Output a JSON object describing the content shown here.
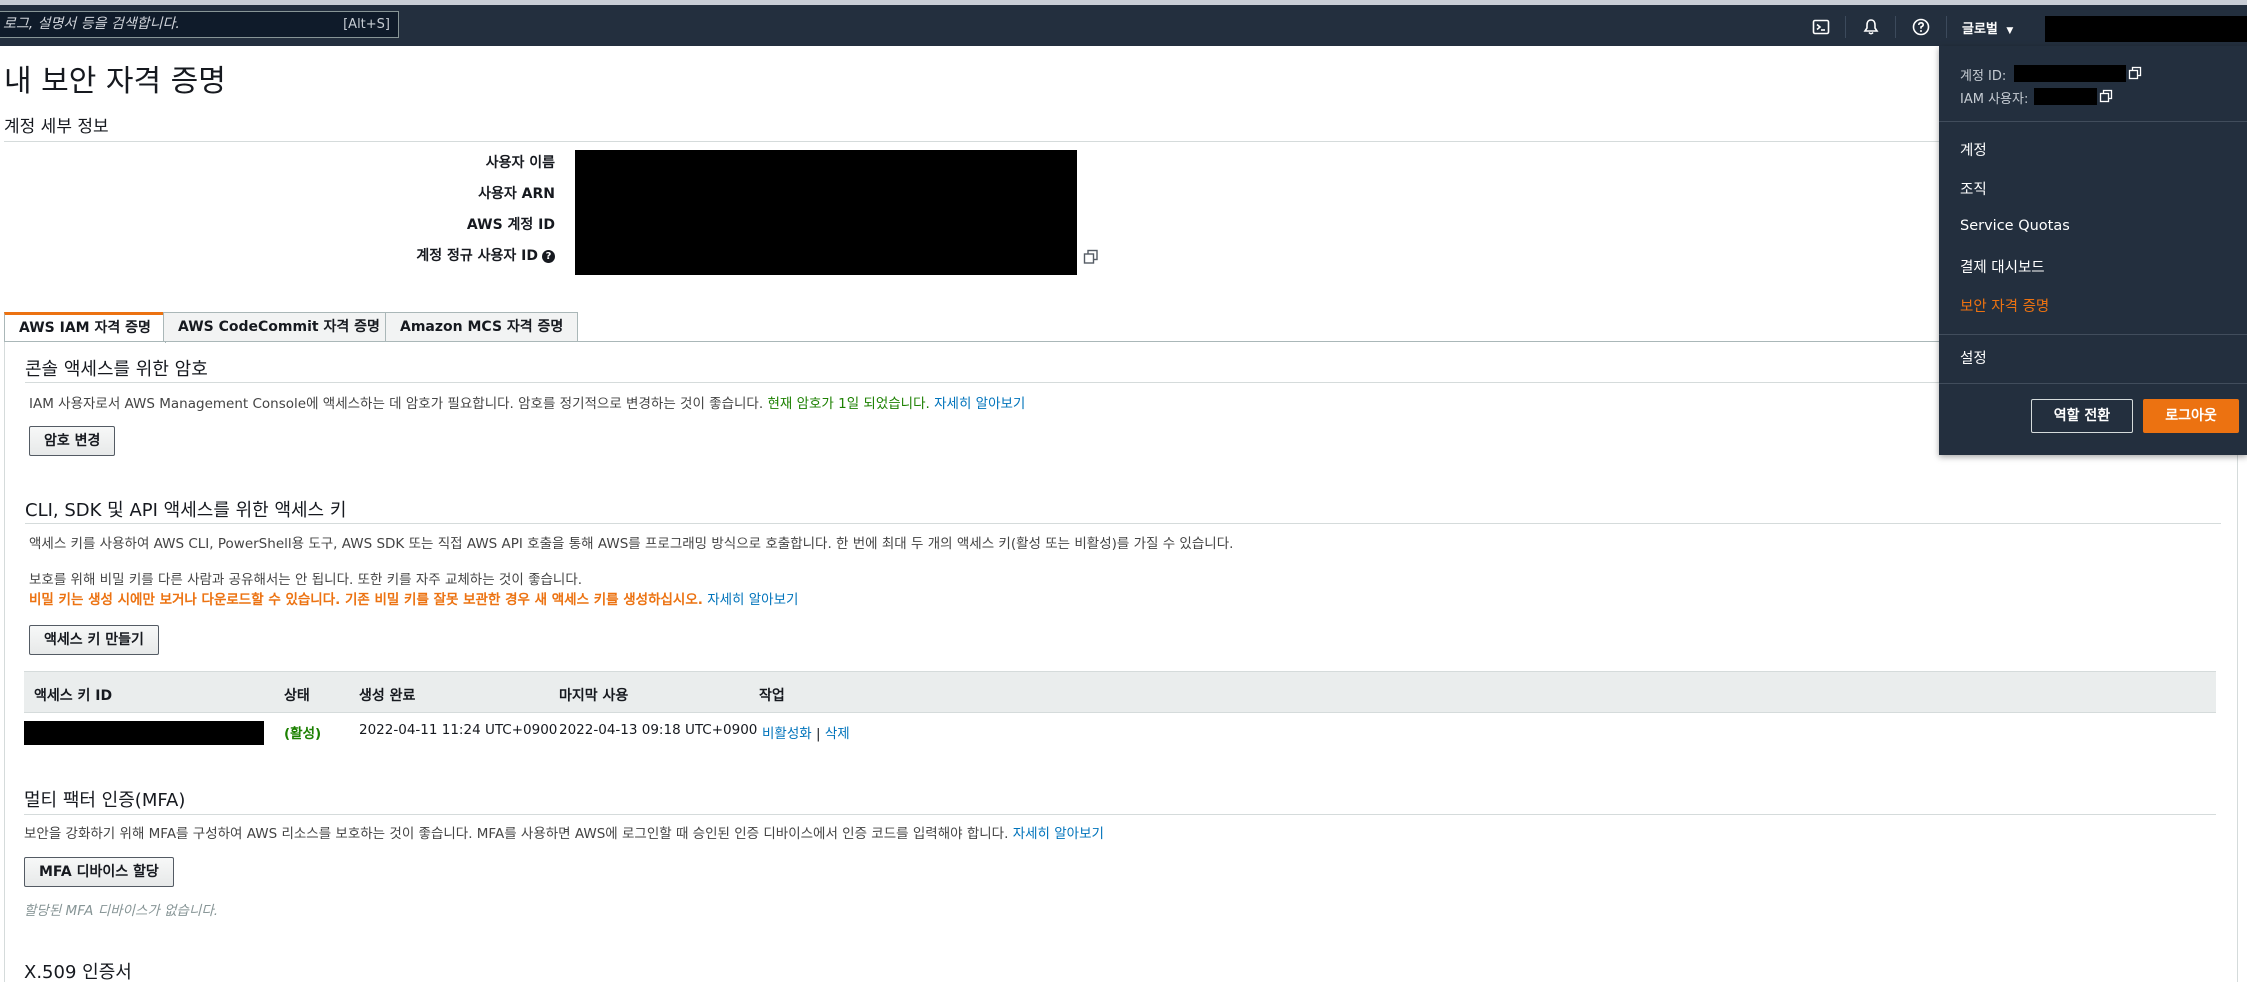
{
  "topnav": {
    "search_placeholder": "로그, 설명서 등을 검색합니다.",
    "search_shortcut": "[Alt+S]",
    "region_label": "글로벌",
    "icons": [
      "cloudshell-icon",
      "bell-icon",
      "help-icon"
    ]
  },
  "page": {
    "title": "내 보안 자격 증명"
  },
  "account_details": {
    "section_title": "계정 세부 정보",
    "labels": {
      "username": "사용자 이름",
      "user_arn": "사용자 ARN",
      "account_id": "AWS 계정 ID",
      "canonical_id": "계정 정규 사용자 ID"
    }
  },
  "tabs": [
    {
      "label": "AWS IAM 자격 증명",
      "active": true
    },
    {
      "label": "AWS CodeCommit 자격 증명",
      "active": false
    },
    {
      "label": "Amazon MCS 자격 증명",
      "active": false
    }
  ],
  "console_password": {
    "title": "콘솔 액세스를 위한 암호",
    "description": "IAM 사용자로서 AWS Management Console에 액세스하는 데 암호가 필요합니다. 암호를 정기적으로 변경하는 것이 좋습니다.",
    "status": "현재 암호가 1일 되었습니다.",
    "learn_more": "자세히 알아보기",
    "button": "암호 변경"
  },
  "access_keys": {
    "title": "CLI, SDK 및 API 액세스를 위한 액세스 키",
    "description": "액세스 키를 사용하여 AWS CLI, PowerShell용 도구, AWS SDK 또는 직접 AWS API 호출을 통해 AWS를 프로그래밍 방식으로 호출합니다. 한 번에 최대 두 개의 액세스 키(활성 또는 비활성)를 가질 수 있습니다.",
    "security_note": "보호를 위해 비밀 키를 다른 사람과 공유해서는 안 됩니다. 또한 키를 자주 교체하는 것이 좋습니다.",
    "warning": "비밀 키는 생성 시에만 보거나 다운로드할 수 있습니다. 기존 비밀 키를 잘못 보관한 경우 새 액세스 키를 생성하십시오.",
    "learn_more": "자세히 알아보기",
    "button": "액세스 키 만들기",
    "columns": [
      "액세스 키 ID",
      "상태",
      "생성 완료",
      "마지막 사용",
      "작업"
    ],
    "rows": [
      {
        "status": "(활성)",
        "created": "2022-04-11 11:24 UTC+0900",
        "last_used": "2022-04-13 09:18 UTC+0900",
        "action_deactivate": "비활성화",
        "action_sep": "|",
        "action_delete": "삭제"
      }
    ]
  },
  "mfa": {
    "title": "멀티 팩터 인증(MFA)",
    "description": "보안을 강화하기 위해 MFA를 구성하여 AWS 리소스를 보호하는 것이 좋습니다. MFA를 사용하면 AWS에 로그인할 때 승인된 인증 디바이스에서 인증 코드를 입력해야 합니다.",
    "learn_more": "자세히 알아보기",
    "button": "MFA 디바이스 할당",
    "empty": "할당된 MFA 디바이스가 없습니다."
  },
  "x509": {
    "title": "X.509 인증서"
  },
  "account_menu": {
    "account_id_label": "계정 ID:",
    "iam_user_label": "IAM 사용자:",
    "items": [
      "계정",
      "조직",
      "Service Quotas",
      "결제 대시보드",
      "보안 자격 증명"
    ],
    "current_item": "보안 자격 증명",
    "settings": "설정",
    "switch_role": "역할 전환",
    "sign_out": "로그아웃"
  },
  "colors": {
    "nav_bg": "#232f3e",
    "accent": "#ec7211",
    "link": "#0073bb",
    "success": "#1d8102"
  }
}
